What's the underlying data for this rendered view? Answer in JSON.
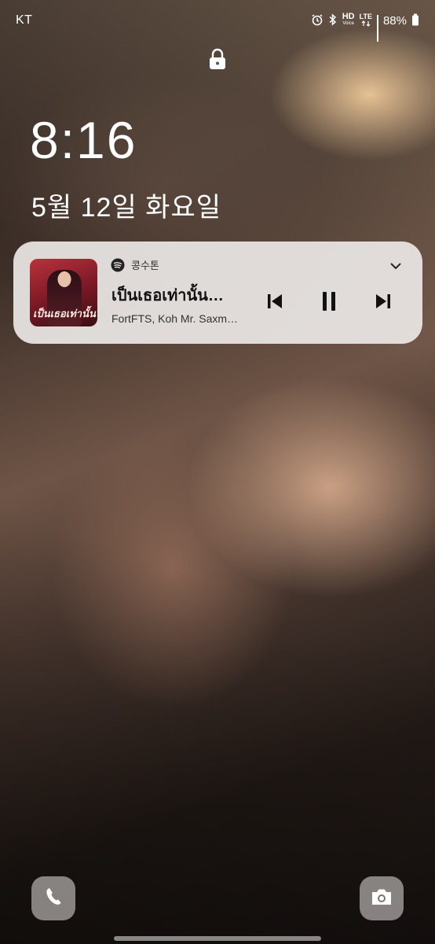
{
  "status_bar": {
    "carrier": "KT",
    "hd_label": "HD",
    "hd_sub": "Voice",
    "lte_label": "LTE",
    "battery": "88%",
    "icons": [
      "alarm-icon",
      "bluetooth-icon",
      "hd-voice-icon",
      "lte-icon",
      "signal-icon",
      "battery-icon"
    ]
  },
  "lock": {
    "icon": "lock-icon"
  },
  "clock": {
    "time": "8:16"
  },
  "date": {
    "text": "5월 12일 화요일"
  },
  "media": {
    "app_icon": "spotify-icon",
    "app_name": "콩수톤",
    "title": "เป็นเธอเท่านั้น…",
    "artist": "FortFTS, Koh Mr. Saxm…",
    "album_art_text": "เป็นเธอเท่านั้น",
    "controls": [
      "previous-icon",
      "pause-icon",
      "next-icon"
    ],
    "expand_icon": "chevron-down-icon",
    "accent": "#111111"
  },
  "shortcuts": {
    "left": "phone-icon",
    "right": "camera-icon"
  }
}
